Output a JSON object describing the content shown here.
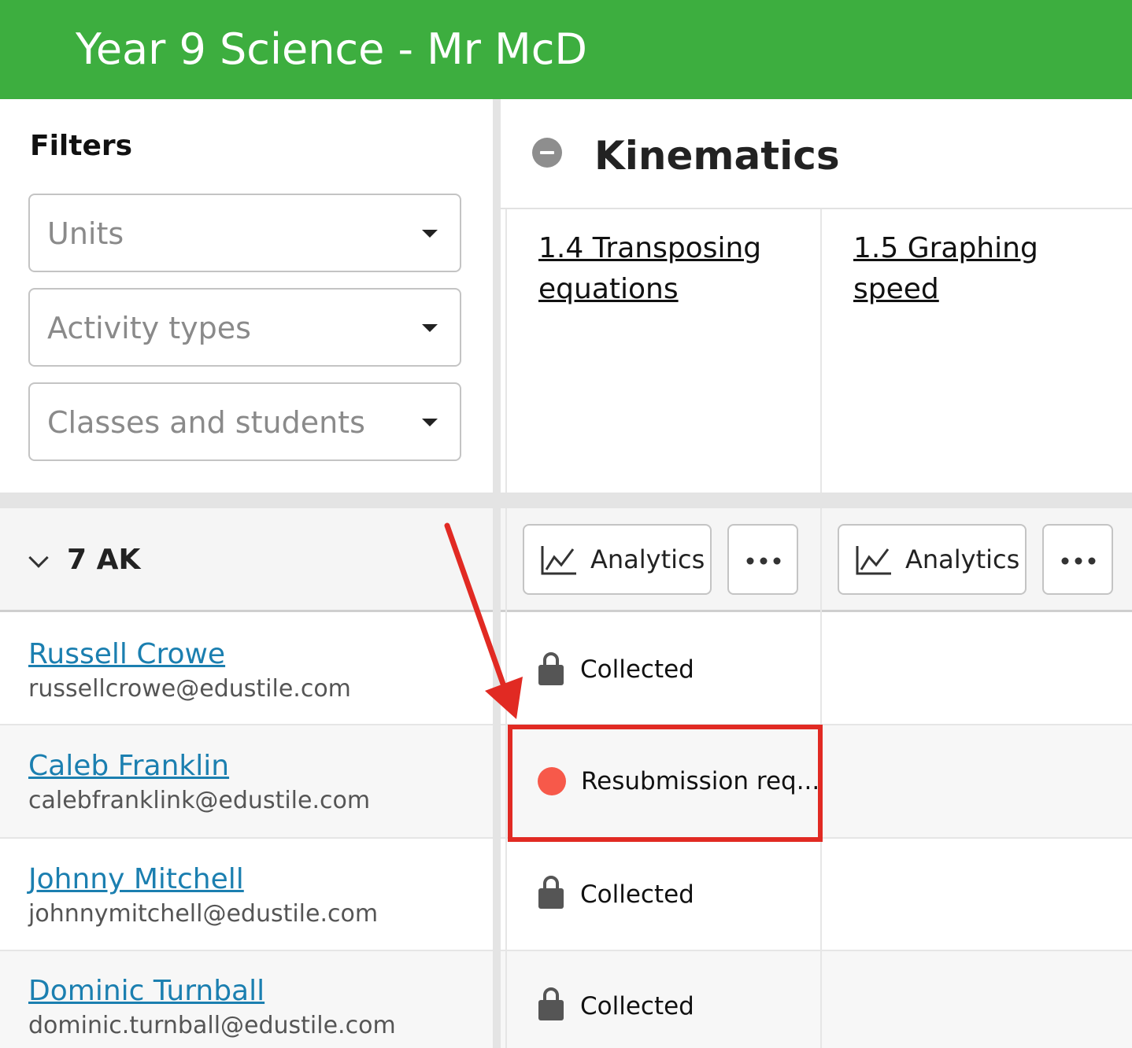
{
  "header": {
    "title": "Year 9 Science - Mr McD"
  },
  "filters": {
    "heading": "Filters",
    "selects": [
      {
        "placeholder": "Units"
      },
      {
        "placeholder": "Activity types"
      },
      {
        "placeholder": "Classes and students"
      }
    ]
  },
  "unit": {
    "title": "Kinematics",
    "activities": [
      {
        "label": "1.4 Transposing equations"
      },
      {
        "label": "1.5 Graphing speed"
      }
    ]
  },
  "class_group": {
    "name": "7 AK",
    "analytics_label": "Analytics"
  },
  "students": [
    {
      "name": "Russell Crowe",
      "email": "russellcrowe@edustile.com",
      "status": "Collected",
      "status_type": "locked"
    },
    {
      "name": "Caleb Franklin",
      "email": "calebfranklink@edustile.com",
      "status": "Resubmission req...",
      "status_type": "resubmission"
    },
    {
      "name": "Johnny Mitchell",
      "email": "johnnymitchell@edustile.com",
      "status": "Collected",
      "status_type": "locked"
    },
    {
      "name": "Dominic Turnball",
      "email": "dominic.turnball@edustile.com",
      "status": "Collected",
      "status_type": "locked"
    }
  ],
  "colors": {
    "header_bg": "#3dae3f",
    "link": "#1b7fb0",
    "resubmission_dot": "#f7594a",
    "annotation": "#e12a23"
  }
}
